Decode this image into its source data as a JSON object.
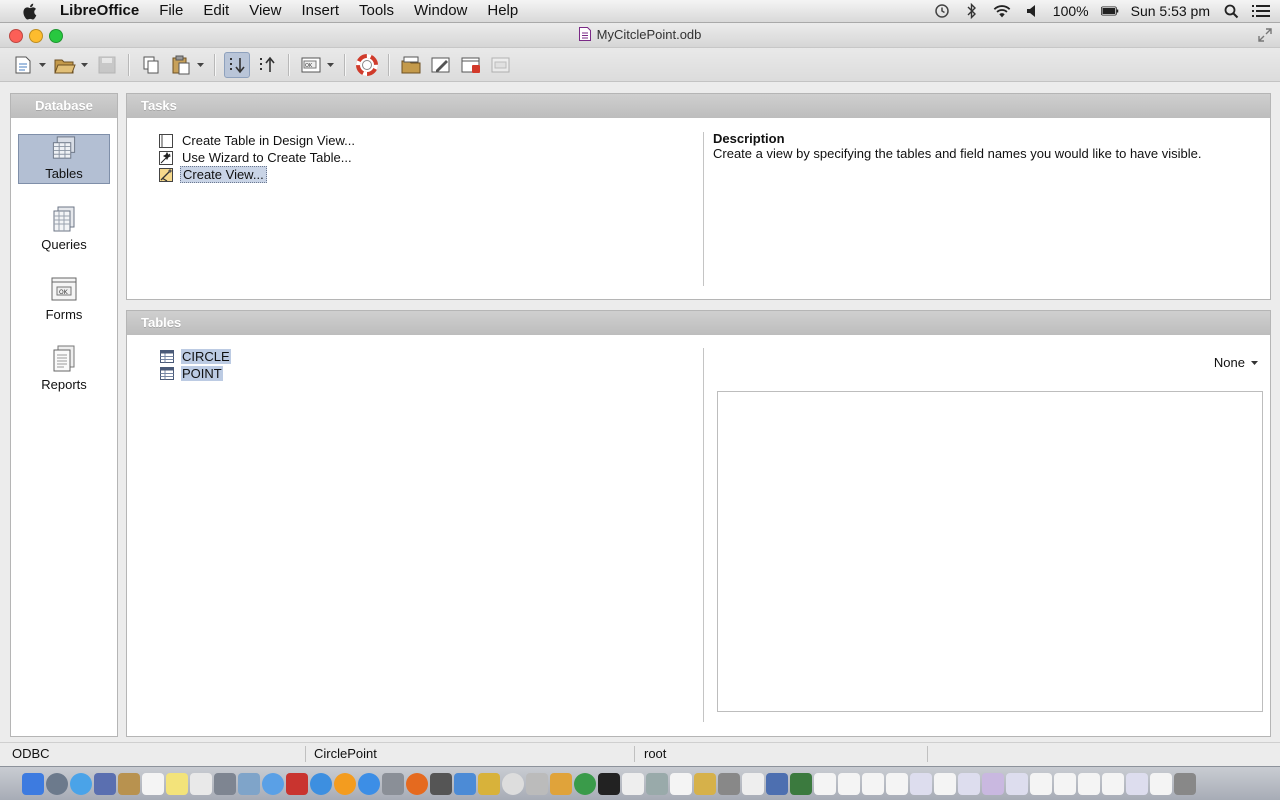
{
  "menubar": {
    "app": "LibreOffice",
    "items": [
      "File",
      "Edit",
      "View",
      "Insert",
      "Tools",
      "Window",
      "Help"
    ],
    "battery": "100%",
    "clock": "Sun 5:53 pm"
  },
  "window": {
    "title": "MyCitclePoint.odb"
  },
  "sidebar": {
    "header": "Database",
    "items": [
      {
        "label": "Tables",
        "icon": "tables-icon",
        "selected": true
      },
      {
        "label": "Queries",
        "icon": "queries-icon"
      },
      {
        "label": "Forms",
        "icon": "forms-icon"
      },
      {
        "label": "Reports",
        "icon": "reports-icon"
      }
    ]
  },
  "tasks": {
    "header": "Tasks",
    "items": [
      {
        "label": "Create Table in Design View...",
        "icon": "design-view-icon"
      },
      {
        "label": "Use Wizard to Create Table...",
        "icon": "wizard-icon"
      },
      {
        "label": "Create View...",
        "icon": "create-view-icon",
        "selected": true
      }
    ],
    "description_title": "Description",
    "description_text": "Create a view by specifying the tables and field names you would like to have visible."
  },
  "tables": {
    "header": "Tables",
    "items": [
      "CIRCLE",
      "POINT"
    ],
    "preview_mode": "None"
  },
  "statusbar": {
    "driver": "ODBC",
    "datasource": "CirclePoint",
    "user": "root"
  },
  "colors": {
    "selection": "#b3bfd3",
    "panel_header": "#c6c6c6"
  }
}
